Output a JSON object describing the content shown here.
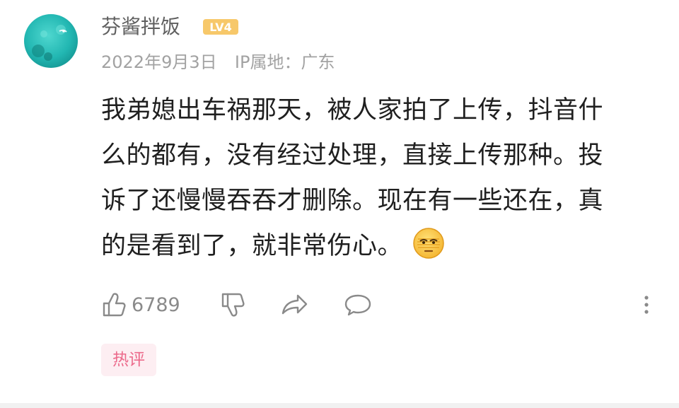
{
  "comment": {
    "username": "芬酱拌饭",
    "level": "LV4",
    "date": "2022年9月3日",
    "ip_location": "IP属地：广东",
    "text_lines": [
      "我弟媳出车祸那天，被人家拍了上传，抖音什",
      "么的都有，没有经过处理，直接上传那种。投",
      "诉了还慢慢吞吞才删除。现在有一些还在，真",
      "的是看到了，就非常伤心。"
    ],
    "emoji_icon": "sleepy-face-emoji-icon",
    "like_count": "6789",
    "tag": "热评"
  },
  "icons": {
    "like": "thumbs-up-icon",
    "dislike": "thumbs-down-icon",
    "share": "share-arrow-icon",
    "reply": "comment-bubble-icon",
    "more": "more-vertical-icon"
  },
  "colors": {
    "username": "#5f5f5f",
    "meta": "#a2a2a2",
    "text": "#1f1f1f",
    "level_badge": "#f7c86a",
    "tag_bg": "#fdeef2",
    "tag_text": "#ec6a8b"
  }
}
